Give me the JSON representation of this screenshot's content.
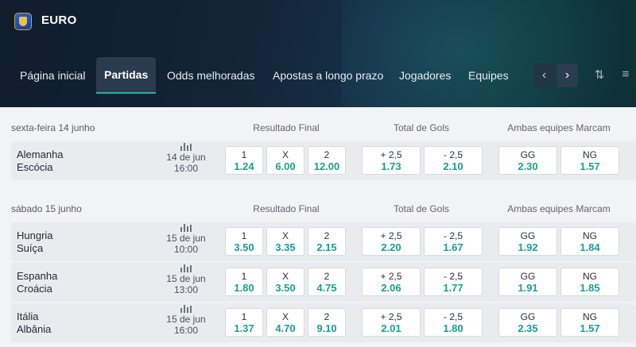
{
  "header": {
    "brand": "EURO",
    "tabs": [
      {
        "label": "Página inicial"
      },
      {
        "label": "Partidas"
      },
      {
        "label": "Odds melhoradas"
      },
      {
        "label": "Apostas a longo prazo"
      },
      {
        "label": "Jogadores"
      },
      {
        "label": "Equipes"
      }
    ],
    "icons": [
      "trophy-icon",
      "chevron-left-icon",
      "chevron-right-icon",
      "collapse-icon",
      "filter-icon"
    ]
  },
  "markets": {
    "result": "Resultado Final",
    "goals": "Total de Gols",
    "btts": "Ambas equipes Marcam"
  },
  "sections": [
    {
      "date": "sexta-feira 14 junho",
      "matches": [
        {
          "home": "Alemanha",
          "away": "Escócia",
          "day": "14 de jun",
          "time": "16:00",
          "result": [
            {
              "label": "1",
              "odd": "1.24"
            },
            {
              "label": "X",
              "odd": "6.00"
            },
            {
              "label": "2",
              "odd": "12.00"
            }
          ],
          "goals": [
            {
              "label": "+ 2,5",
              "odd": "1.73"
            },
            {
              "label": "- 2,5",
              "odd": "2.10"
            }
          ],
          "btts": [
            {
              "label": "GG",
              "odd": "2.30"
            },
            {
              "label": "NG",
              "odd": "1.57"
            }
          ]
        }
      ]
    },
    {
      "date": "sábado 15 junho",
      "matches": [
        {
          "home": "Hungria",
          "away": "Suíça",
          "day": "15 de jun",
          "time": "10:00",
          "result": [
            {
              "label": "1",
              "odd": "3.50"
            },
            {
              "label": "X",
              "odd": "3.35"
            },
            {
              "label": "2",
              "odd": "2.15"
            }
          ],
          "goals": [
            {
              "label": "+ 2,5",
              "odd": "2.20"
            },
            {
              "label": "- 2,5",
              "odd": "1.67"
            }
          ],
          "btts": [
            {
              "label": "GG",
              "odd": "1.92"
            },
            {
              "label": "NG",
              "odd": "1.84"
            }
          ]
        },
        {
          "home": "Espanha",
          "away": "Croácia",
          "day": "15 de jun",
          "time": "13:00",
          "result": [
            {
              "label": "1",
              "odd": "1.80"
            },
            {
              "label": "X",
              "odd": "3.50"
            },
            {
              "label": "2",
              "odd": "4.75"
            }
          ],
          "goals": [
            {
              "label": "+ 2,5",
              "odd": "2.06"
            },
            {
              "label": "- 2,5",
              "odd": "1.77"
            }
          ],
          "btts": [
            {
              "label": "GG",
              "odd": "1.91"
            },
            {
              "label": "NG",
              "odd": "1.85"
            }
          ]
        },
        {
          "home": "Itália",
          "away": "Albânia",
          "day": "15 de jun",
          "time": "16:00",
          "result": [
            {
              "label": "1",
              "odd": "1.37"
            },
            {
              "label": "X",
              "odd": "4.70"
            },
            {
              "label": "2",
              "odd": "9.10"
            }
          ],
          "goals": [
            {
              "label": "+ 2,5",
              "odd": "2.01"
            },
            {
              "label": "- 2,5",
              "odd": "1.80"
            }
          ],
          "btts": [
            {
              "label": "GG",
              "odd": "2.35"
            },
            {
              "label": "NG",
              "odd": "1.57"
            }
          ]
        }
      ]
    }
  ]
}
